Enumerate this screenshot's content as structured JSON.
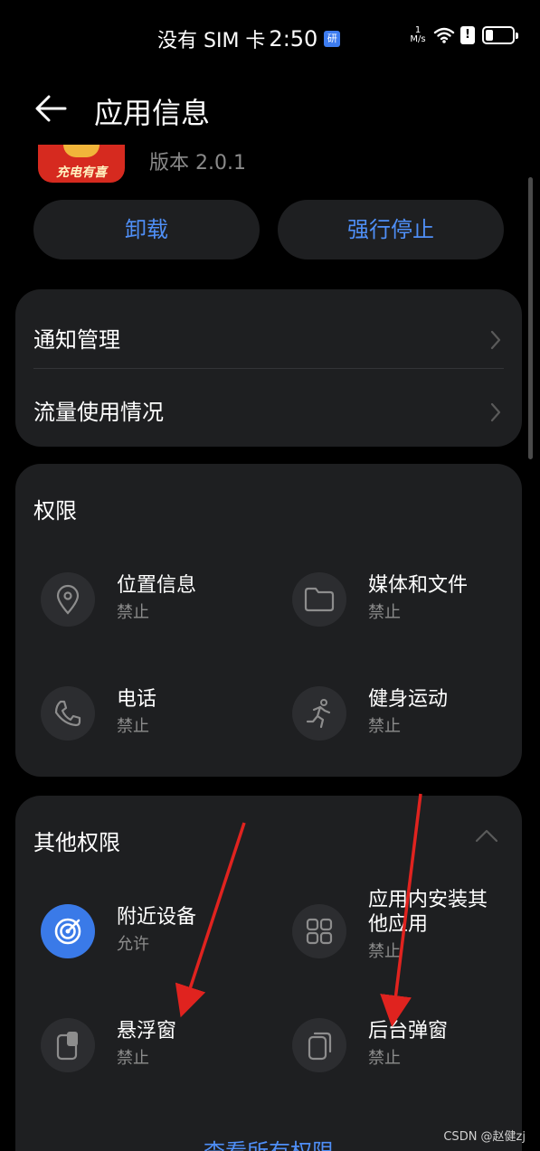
{
  "status_bar": {
    "carrier": "没有 SIM 卡",
    "time": "2:50",
    "badge": "研",
    "net_speed_top": "1",
    "net_speed_bottom": "M/s",
    "alert": "!"
  },
  "header": {
    "title": "应用信息",
    "back_icon": "arrow-left-icon"
  },
  "app": {
    "icon_text": "充电有喜",
    "version": "版本 2.0.1"
  },
  "actions": {
    "uninstall_label": "卸载",
    "force_stop_label": "强行停止"
  },
  "settings_rows": [
    {
      "label": "通知管理",
      "icon": "chevron-right-icon"
    },
    {
      "label": "流量使用情况",
      "icon": "chevron-right-icon"
    }
  ],
  "permissions": {
    "title": "权限",
    "items": [
      {
        "title": "位置信息",
        "status": "禁止",
        "icon": "location-pin-icon"
      },
      {
        "title": "媒体和文件",
        "status": "禁止",
        "icon": "folder-icon"
      },
      {
        "title": "电话",
        "status": "禁止",
        "icon": "phone-icon"
      },
      {
        "title": "健身运动",
        "status": "禁止",
        "icon": "running-icon"
      }
    ]
  },
  "other_permissions": {
    "title": "其他权限",
    "items": [
      {
        "title": "附近设备",
        "status": "允许",
        "icon": "radar-icon"
      },
      {
        "title": "应用内安装其他应用",
        "status": "禁止",
        "icon": "apps-grid-icon"
      },
      {
        "title": "悬浮窗",
        "status": "禁止",
        "icon": "floating-window-icon"
      },
      {
        "title": "后台弹窗",
        "status": "禁止",
        "icon": "background-popup-icon"
      }
    ],
    "view_all": "查看所有权限"
  },
  "watermark": "CSDN @赵健zj",
  "colors": {
    "accent": "#4f8ff7",
    "card": "#1e1f21",
    "annotation_arrow": "#e0231f"
  }
}
